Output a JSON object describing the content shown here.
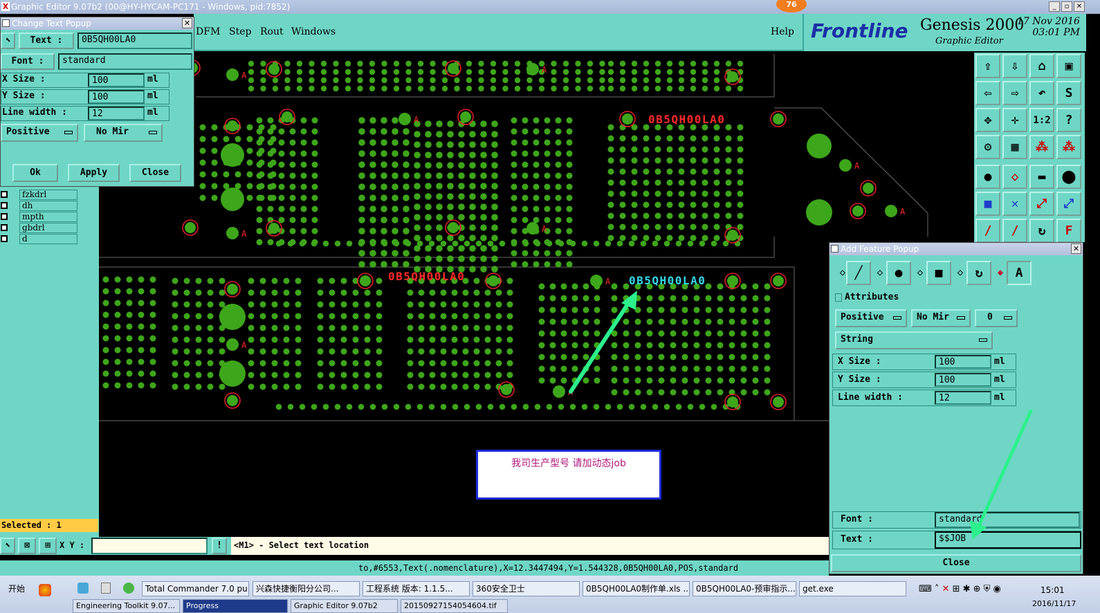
{
  "window": {
    "title": "Graphic Editor 9.07b2 (00@HY-HYCAM-PC171 - Windows, pid:7852)",
    "badge": "76"
  },
  "menu": {
    "items": [
      "DFM",
      "Step",
      "Rout",
      "Windows"
    ],
    "help": "Help"
  },
  "logo": {
    "brand": "Frontline",
    "product": "Genesis 2000",
    "subtitle": "Graphic Editor",
    "date": "17 Nov 2016",
    "time": "03:01 PM"
  },
  "change_text": {
    "title": "Change Text Popup",
    "text_label": "Text :",
    "text_value": "0B5QH00LA0",
    "font_label": "Font :",
    "font_value": "standard",
    "xsize_label": "X Size     :",
    "xsize_value": "100",
    "xsize_unit": "ml",
    "ysize_label": "Y Size     :",
    "ysize_value": "100",
    "ysize_unit": "ml",
    "lw_label": "Line width  :",
    "lw_value": "12",
    "lw_unit": "ml",
    "polarity": "Positive",
    "mirror": "No Mir",
    "ok": "Ok",
    "apply": "Apply",
    "close": "Close"
  },
  "layers": [
    "fzkdrl",
    "dh",
    "mpth",
    "gbdrl",
    "d"
  ],
  "selected": "Selected : 1",
  "board": {
    "labels_red": [
      "0B5QH00LA0",
      "0B5QH00LA0"
    ],
    "label_cyan": "0B5QH00LA0",
    "pad_marker": "A",
    "note": "我司生产型号  请加动态job"
  },
  "add_feature": {
    "title": "Add Feature Popup",
    "attributes": "Attributes",
    "polarity": "Positive",
    "mirror": "No Mir",
    "angle": "0",
    "type": "String",
    "xsize_label": "X Size      :",
    "xsize_value": "100",
    "xsize_unit": "ml",
    "ysize_label": "Y Size      :",
    "ysize_value": "100",
    "ysize_unit": "ml",
    "lw_label": "Line width  :",
    "lw_value": "12",
    "lw_unit": "ml",
    "font_label": "Font        :",
    "font_value": "standard",
    "text_label": "Text        :",
    "text_value": "$$JOB",
    "close": "Close"
  },
  "command": {
    "xy_label": "X Y :",
    "xy_value": "",
    "prompt": "<M1> - Select text location"
  },
  "status": "to,#6553,Text(.nomenclature),X=12.3447494,Y=1.544328,0B5QH00LA0,POS,standard",
  "taskbar": {
    "start": "开始",
    "tasks": [
      "Total Commander 7.0 pu...",
      "兴森快捷衡阳分公司...",
      "工程系统  版本: 1.1.5...",
      "360安全卫士",
      "0B5QH00LA0制作单.xls ...",
      "0B5QH00LA0-预审指示...",
      "get.exe"
    ],
    "tasks_row2": [
      "Engineering Toolkit 9.07...",
      "Progress",
      "Graphic Editor 9.07b2",
      "20150927154054604.tif"
    ],
    "clock": "15:01",
    "clock_date": "2016/11/17"
  },
  "colors": {
    "panel": "#6fd6c6",
    "pad": "#3ea61a",
    "drill_ring": "#e0202a",
    "text_red": "#ff2a2a",
    "text_cyan": "#36d7e8",
    "arrow": "#2cf08c",
    "selected": "#ffcb45"
  }
}
